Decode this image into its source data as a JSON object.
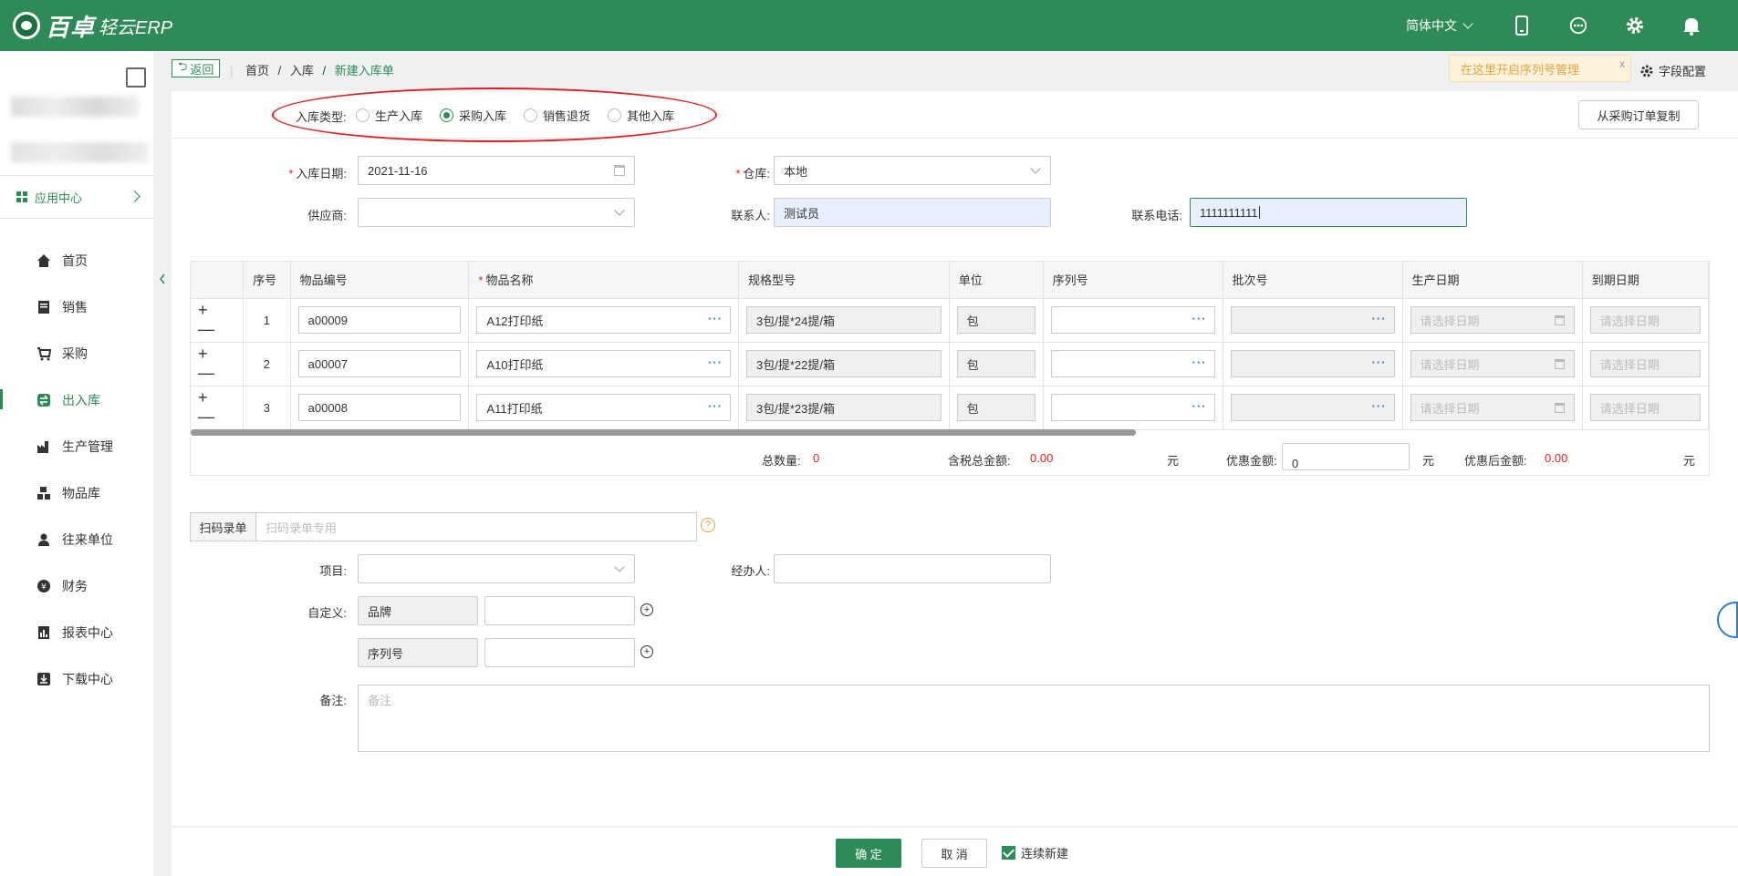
{
  "app": {
    "brand": "百卓",
    "product": "轻云ERP"
  },
  "topbar": {
    "language": "简体中文"
  },
  "sidebar": {
    "app_center": "应用中心",
    "items": [
      {
        "label": "首页",
        "icon": "home-icon"
      },
      {
        "label": "销售",
        "icon": "sales-icon"
      },
      {
        "label": "采购",
        "icon": "cart-icon"
      },
      {
        "label": "出入库",
        "icon": "inout-icon",
        "active": true
      },
      {
        "label": "生产管理",
        "icon": "factory-icon"
      },
      {
        "label": "物品库",
        "icon": "boxes-icon"
      },
      {
        "label": "往来单位",
        "icon": "contacts-icon"
      },
      {
        "label": "财务",
        "icon": "finance-icon"
      },
      {
        "label": "报表中心",
        "icon": "report-icon"
      },
      {
        "label": "下载中心",
        "icon": "download-icon"
      }
    ]
  },
  "breadcrumb": {
    "back": "返回",
    "items": [
      "首页",
      "入库",
      "新建入库单"
    ],
    "separator": "/"
  },
  "tip": {
    "text": "在这里开启序列号管理",
    "close": "x"
  },
  "field_config": "字段配置",
  "type": {
    "label": "入库类型:",
    "options": [
      "生产入库",
      "采购入库",
      "销售退货",
      "其他入库"
    ],
    "selected": "采购入库"
  },
  "copy_button": "从采购订单复制",
  "form": {
    "date_label": "入库日期:",
    "date_value": "2021-11-16",
    "warehouse_label": "仓库:",
    "warehouse_value": "本地",
    "supplier_label": "供应商:",
    "supplier_value": "",
    "contact_label": "联系人:",
    "contact_value": "测试员",
    "phone_label": "联系电话:",
    "phone_value": "1111111111"
  },
  "table": {
    "headers": [
      "序号",
      "物品编号",
      "物品名称",
      "规格型号",
      "单位",
      "序列号",
      "批次号",
      "生产日期",
      "到期日期"
    ],
    "date_placeholder": "请选择日期",
    "rows": [
      {
        "no": "1",
        "code": "a00009",
        "name": "A12打印纸",
        "spec": "3包/提*24提/箱",
        "unit": "包"
      },
      {
        "no": "2",
        "code": "a00007",
        "name": "A10打印纸",
        "spec": "3包/提*22提/箱",
        "unit": "包"
      },
      {
        "no": "3",
        "code": "a00008",
        "name": "A11打印纸",
        "spec": "3包/提*23提/箱",
        "unit": "包"
      }
    ],
    "row_actions": "+ —",
    "dots": "···"
  },
  "totals": {
    "qty_label": "总数量:",
    "qty_value": "0",
    "tax_total_label": "含税总金额:",
    "tax_total_value": "0.00",
    "yuan": "元",
    "discount_label": "优惠金额:",
    "discount_value": "0",
    "after_discount_label": "优惠后金额:",
    "after_discount_value": "0.00"
  },
  "scan": {
    "label": "扫码录单",
    "placeholder": "扫码录单专用",
    "help": "?"
  },
  "extra": {
    "project_label": "项目:",
    "handler_label": "经办人:",
    "custom_label": "自定义:",
    "custom1": "品牌",
    "custom2": "序列号",
    "remark_label": "备注:",
    "remark_placeholder": "备注"
  },
  "footer": {
    "ok": "确 定",
    "cancel": "取 消",
    "continue": "连续新建"
  },
  "colors": {
    "primary": "#2e8b57",
    "danger": "#e02020",
    "warning": "#e6a23c",
    "link": "#2e7bd0"
  }
}
